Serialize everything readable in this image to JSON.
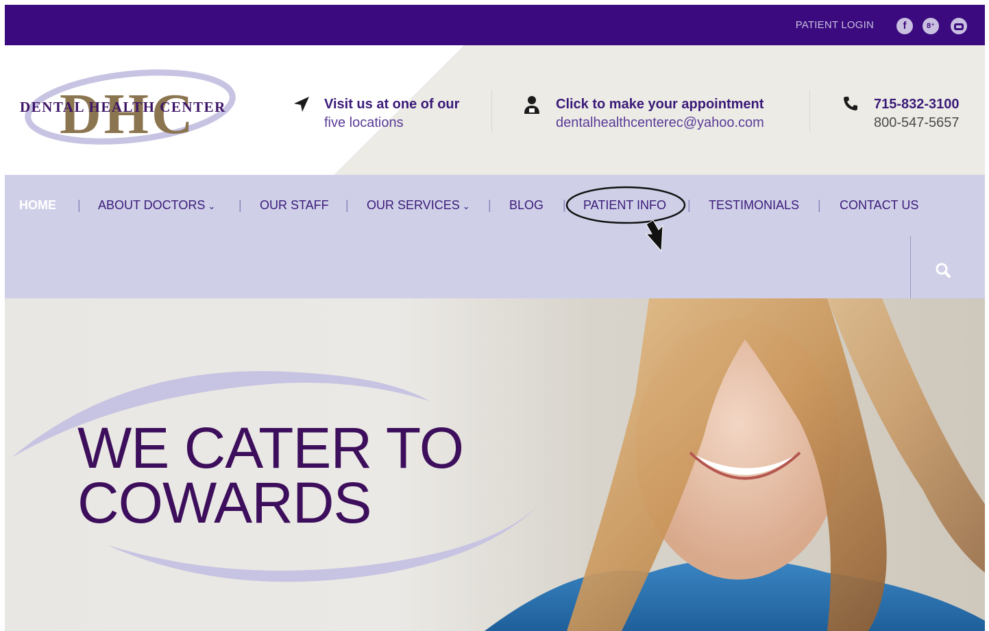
{
  "topbar": {
    "login_label": "PATIENT LOGIN",
    "social": [
      {
        "icon": "facebook-icon",
        "glyph": "f"
      },
      {
        "icon": "google-plus-icon",
        "glyph": "8⁺"
      },
      {
        "icon": "youtube-icon",
        "glyph": "You\nTube"
      }
    ]
  },
  "header": {
    "logo_text": "DENTAL HEALTH CENTER",
    "logo_letters": "DHC",
    "locations": {
      "line1": "Visit us at one of our",
      "line2": "five locations",
      "icon": "location-arrow-icon"
    },
    "appointment": {
      "line1": "Click to make your appointment",
      "line2": "dentalhealthcenterec@yahoo.com",
      "icon": "doctor-icon"
    },
    "phone": {
      "line1": "715-832-3100",
      "line2": "800-547-5657",
      "icon": "phone-icon"
    }
  },
  "nav": {
    "items": [
      {
        "label": "HOME"
      },
      {
        "label": "ABOUT DOCTORS"
      },
      {
        "label": "OUR STAFF"
      },
      {
        "label": "OUR SERVICES"
      },
      {
        "label": "BLOG"
      },
      {
        "label": "PATIENT INFO"
      },
      {
        "label": "TESTIMONIALS"
      },
      {
        "label": "CONTACT US"
      }
    ],
    "separator": "|",
    "caret": "⌄"
  },
  "hero": {
    "line1": "WE CATER TO",
    "line2": "COWARDS"
  },
  "colors": {
    "topbar": "#3a0a7e",
    "nav_bg": "#cfcfe8",
    "brand_purple": "#3a1a78",
    "headline": "#3d0e5c"
  }
}
